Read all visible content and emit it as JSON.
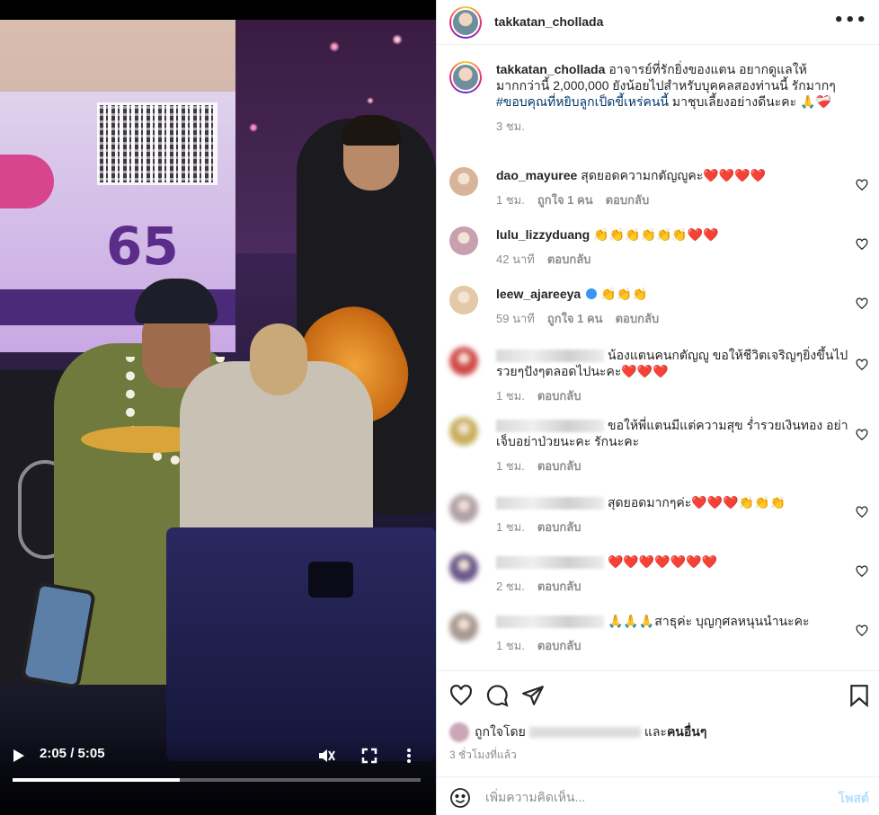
{
  "video": {
    "time": "2:05 / 5:05",
    "progress": 0.41
  },
  "post": {
    "username": "takkatan_chollada",
    "more_label": "•••",
    "caption_text": "อาจารย์ที่รักยิ่งของแตน อยากดูแลให้มากกว่านี้ 2,000,000 ยังน้อยไปสำหรับบุคคลสองท่านนี้ รักมากๆ ",
    "caption_hashtag": "#ขอบคุณที่หยิบลูกเป็ดขี้เหร่คนนี้",
    "caption_tail": " มาชุบเลี้ยงอย่างดีนะคะ 🙏❤️‍🩹",
    "caption_time": "3 ชม."
  },
  "comments": [
    {
      "user": "dao_mayuree",
      "text": "สุดยอดความกตัญญูคะ❤️❤️❤️❤️",
      "time": "1 ชม.",
      "likes": "ถูกใจ 1 คน",
      "reply": "ตอบกลับ",
      "avatar_color": "#d8b49a"
    },
    {
      "user": "lulu_lizzyduang",
      "text": "👏👏👏👏👏👏❤️❤️",
      "time": "42 นาที",
      "likes": "",
      "reply": "ตอบกลับ",
      "avatar_color": "#c8a0b0"
    },
    {
      "user": "leew_ajareeya",
      "verified": true,
      "text": "👏👏👏",
      "time": "59 นาที",
      "likes": "ถูกใจ 1 คน",
      "reply": "ตอบกลับ",
      "avatar_color": "#e3c9a8"
    },
    {
      "user": "",
      "text": "น้องแตนคนกตัญญู ขอให้ชีวิตเจริญๆยิ่งขึ้นไปรวยๆปังๆตลอดไปนะคะ❤️❤️❤️",
      "time": "1 ชม.",
      "likes": "",
      "reply": "ตอบกลับ",
      "avatar_color": "#d04a4a",
      "hidden_user": true
    },
    {
      "user": "",
      "text": "ขอให้พี่แตนมีแต่ความสุข ร่ำรวยเงินทอง อย่าเจ็บอย่าป่วยนะคะ รักนะคะ",
      "time": "1 ชม.",
      "likes": "",
      "reply": "ตอบกลับ",
      "avatar_color": "#c8b060",
      "hidden_user": true
    },
    {
      "user": "",
      "text": "สุดยอดมากๆค่ะ❤️❤️❤️👏👏👏",
      "time": "1 ชม.",
      "likes": "",
      "reply": "ตอบกลับ",
      "avatar_color": "#b0a0a8",
      "hidden_user": true
    },
    {
      "user": "",
      "text": "❤️❤️❤️❤️❤️❤️❤️",
      "time": "2 ชม.",
      "likes": "",
      "reply": "ตอบกลับ",
      "avatar_color": "#6a5a8a",
      "hidden_user": true
    },
    {
      "user": "",
      "text": "🙏🙏🙏สาธุค่ะ บุญกุศลหนุนนำนะคะ",
      "time": "1 ชม.",
      "likes": "",
      "reply": "ตอบกลับ",
      "avatar_color": "#a89890",
      "hidden_user": true
    }
  ],
  "actions": {
    "liked_prefix": "ถูกใจโดย",
    "liked_and": "และ",
    "liked_others": "คนอื่นๆ",
    "posted_ago": "3 ชั่วโมงที่แล้ว"
  },
  "add_comment": {
    "placeholder": "เพิ่มความคิดเห็น...",
    "post_label": "โพสต์"
  },
  "icons": [
    "play-icon",
    "mute-icon",
    "fullscreen-icon",
    "more-icon",
    "heart-icon",
    "comment-icon",
    "share-icon",
    "bookmark-icon",
    "emoji-icon"
  ]
}
